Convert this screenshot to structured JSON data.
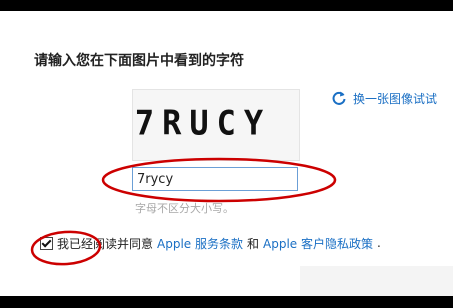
{
  "prompt": "请输入您在下面图片中看到的字符",
  "captcha": {
    "text": "7RUCY"
  },
  "refresh": {
    "label": "换一张图像试试",
    "icon": "refresh-icon"
  },
  "input": {
    "value": "7rycy"
  },
  "hint": "字母不区分大小写。",
  "agreement": {
    "text_before": "我已经阅读并同意",
    "link1": "Apple 服务条款",
    "and": "和",
    "link2": "Apple 客户隐私政策",
    "end": ".",
    "checked": true
  },
  "colors": {
    "link": "#1a6fc4",
    "annotation": "#cc0000"
  }
}
